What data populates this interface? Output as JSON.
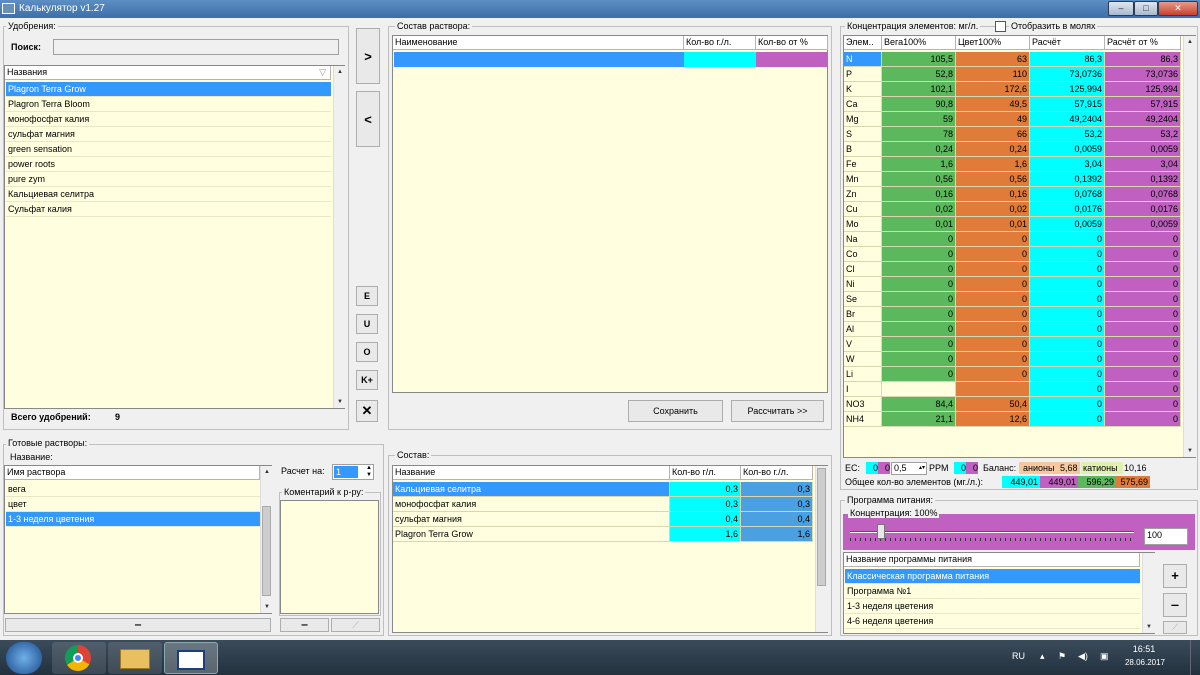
{
  "window": {
    "title": "Калькулятор v1.27",
    "min": "‒",
    "max": "□",
    "close": "✕"
  },
  "fertilizers": {
    "group_label": "Удобрения:",
    "search_label": "Поиск:",
    "search_value": "",
    "column": "Названия",
    "items": [
      "Plagron Terra Grow",
      "Plagron Terra Bloom",
      "монофосфат калия",
      "сульфат магния",
      "green sensation",
      "power roots",
      "pure zym",
      "Кальциевая селитра",
      "Сульфат калия"
    ],
    "selected_index": 0,
    "total_label": "Всего удобрений:",
    "total_value": "9"
  },
  "middle_buttons": {
    "add": ">",
    "remove": "<",
    "e": "E",
    "u": "U",
    "o": "O",
    "kplus": "K+",
    "delete": "✕"
  },
  "solution": {
    "group_label": "Состав раствора:",
    "columns": [
      "Наименование",
      "Кол-во г./л.",
      "Кол-во от %"
    ],
    "save": "Сохранить",
    "calculate": "Рассчитать >>"
  },
  "concentration": {
    "group_label": "Концентрация элементов: мг/л.",
    "moles_label": "Отобразить в молях",
    "moles_checked": false,
    "columns": [
      "Элем..",
      "Вега100%",
      "Цвет100%",
      "Расчёт",
      "Расчёт от %"
    ],
    "rows": [
      [
        "N",
        "105,5",
        "63",
        "86,3",
        "86,3"
      ],
      [
        "P",
        "52,8",
        "110",
        "73,0736",
        "73,0736"
      ],
      [
        "K",
        "102,1",
        "172,6",
        "125,994",
        "125,994"
      ],
      [
        "Ca",
        "90,8",
        "49,5",
        "57,915",
        "57,915"
      ],
      [
        "Mg",
        "59",
        "49",
        "49,2404",
        "49,2404"
      ],
      [
        "S",
        "78",
        "66",
        "53,2",
        "53,2"
      ],
      [
        "B",
        "0,24",
        "0,24",
        "0,0059",
        "0,0059"
      ],
      [
        "Fe",
        "1,6",
        "1,6",
        "3,04",
        "3,04"
      ],
      [
        "Mn",
        "0,56",
        "0,56",
        "0,1392",
        "0,1392"
      ],
      [
        "Zn",
        "0,16",
        "0,16",
        "0,0768",
        "0,0768"
      ],
      [
        "Cu",
        "0,02",
        "0,02",
        "0,0176",
        "0,0176"
      ],
      [
        "Mo",
        "0,01",
        "0,01",
        "0,0059",
        "0,0059"
      ],
      [
        "Na",
        "0",
        "0",
        "0",
        "0"
      ],
      [
        "Co",
        "0",
        "0",
        "0",
        "0"
      ],
      [
        "Cl",
        "0",
        "0",
        "0",
        "0"
      ],
      [
        "Ni",
        "0",
        "0",
        "0",
        "0"
      ],
      [
        "Se",
        "0",
        "0",
        "0",
        "0"
      ],
      [
        "Br",
        "0",
        "0",
        "0",
        "0"
      ],
      [
        "Al",
        "0",
        "0",
        "0",
        "0"
      ],
      [
        "V",
        "0",
        "0",
        "0",
        "0"
      ],
      [
        "W",
        "0",
        "0",
        "0",
        "0"
      ],
      [
        "Li",
        "0",
        "0",
        "0",
        "0"
      ],
      [
        "I",
        "",
        "",
        "0",
        "0"
      ],
      [
        "NO3",
        "84,4",
        "50,4",
        "0",
        "0"
      ],
      [
        "NH4",
        "21,1",
        "12,6",
        "0",
        "0"
      ]
    ],
    "colors": {
      "vega": "#5cb85c",
      "cvet": "#e07b39",
      "calc": "#00ffff",
      "calcp": "#c060c0"
    },
    "ec_label": "EC:",
    "ec_vals": [
      "0",
      "0"
    ],
    "spin_value": "0,5",
    "ppm_label": "PPM",
    "ppm_vals": [
      "0",
      "0"
    ],
    "balance_label": "Баланс:",
    "anions_label": "анионы",
    "anions_value": "5,68",
    "cations_label": "катионы",
    "cations_value": "10,16",
    "total_label": "Общее кол-во элементов (мг./л.):",
    "totals": [
      "449,01",
      "449,01",
      "596,29",
      "575,69"
    ]
  },
  "ready": {
    "group_label": "Готовые растворы:",
    "name_label": "Название:",
    "column": "Имя раствора",
    "items": [
      "вега",
      "цвет",
      "1-3 неделя цветения"
    ],
    "selected_index": 2,
    "minus": "‒",
    "calc_for_label": "Расчет на:",
    "calc_for_value": "1",
    "comment_label": "Коментарий к р-ру:",
    "minus2": "‒"
  },
  "composition": {
    "group_label": "Состав:",
    "columns": [
      "Название",
      "Кол-во г/л.",
      "Кол-во г./л."
    ],
    "rows": [
      [
        "Кальциевая селитра",
        "0,3",
        "0,3"
      ],
      [
        "монофосфат калия",
        "0,3",
        "0,3"
      ],
      [
        "сульфат магния",
        "0,4",
        "0,4"
      ],
      [
        "Plagron Terra Grow",
        "1,6",
        "1,6"
      ]
    ],
    "selected_index": 0
  },
  "program": {
    "group_label": "Программа питания:",
    "conc_label": "Концентрация: 100%",
    "slider_fraction": 0.11,
    "value": "100",
    "column": "Название программы питания",
    "items": [
      "Классическая программа питания",
      "Программа №1",
      "1-3 неделя цветения",
      "4-6 неделя цветения"
    ],
    "selected_index": 0,
    "plus": "+",
    "minus": "‒"
  },
  "taskbar": {
    "lang": "RU",
    "time": "16:51",
    "date": "28.06.2017"
  }
}
